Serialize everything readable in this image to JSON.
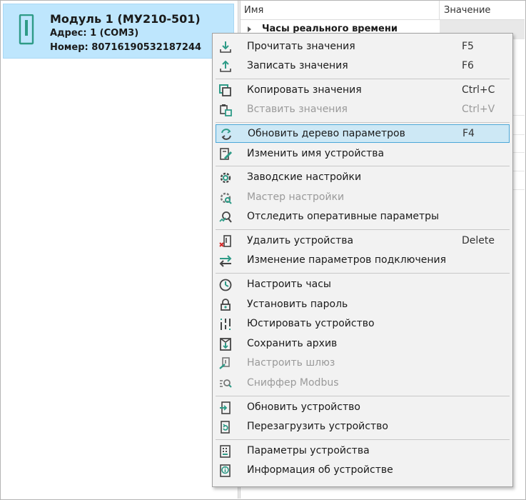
{
  "device": {
    "name": "Модуль 1 (МУ210-501)",
    "address": "Адрес: 1 (COM3)",
    "number": "Номер: 80716190532187244"
  },
  "grid": {
    "col_name": "Имя",
    "col_value": "Значение",
    "rows": [
      {
        "label": "Часы реального времени",
        "expanded": false
      }
    ]
  },
  "menu": {
    "items": [
      {
        "label": "Прочитать значения",
        "shortcut": "F5",
        "icon": "read-values-icon",
        "enabled": true
      },
      {
        "label": "Записать значения",
        "shortcut": "F6",
        "icon": "write-values-icon",
        "enabled": true
      },
      {
        "label": "Копировать значения",
        "shortcut": "Ctrl+C",
        "icon": "copy-icon",
        "enabled": true
      },
      {
        "label": "Вставить значения",
        "shortcut": "Ctrl+V",
        "icon": "paste-icon",
        "enabled": false
      },
      {
        "label": "Обновить дерево параметров",
        "shortcut": "F4",
        "icon": "refresh-tree-icon",
        "enabled": true,
        "highlighted": true
      },
      {
        "label": "Изменить имя устройства",
        "shortcut": "",
        "icon": "rename-device-icon",
        "enabled": true
      },
      {
        "label": "Заводские настройки",
        "shortcut": "",
        "icon": "factory-settings-gear-icon",
        "enabled": true
      },
      {
        "label": "Мастер настройки",
        "shortcut": "",
        "icon": "setup-wizard-icon",
        "enabled": false
      },
      {
        "label": "Отследить оперативные параметры",
        "shortcut": "",
        "icon": "track-parameters-icon",
        "enabled": true
      },
      {
        "label": "Удалить устройства",
        "shortcut": "Delete",
        "icon": "delete-device-icon",
        "enabled": true
      },
      {
        "label": "Изменение параметров подключения",
        "shortcut": "",
        "icon": "connection-arrows-icon",
        "enabled": true
      },
      {
        "label": "Настроить часы",
        "shortcut": "",
        "icon": "clock-icon",
        "enabled": true
      },
      {
        "label": "Установить пароль",
        "shortcut": "",
        "icon": "password-lock-icon",
        "enabled": true
      },
      {
        "label": "Юстировать устройство",
        "shortcut": "",
        "icon": "calibrate-icon",
        "enabled": true
      },
      {
        "label": "Сохранить архив",
        "shortcut": "",
        "icon": "save-archive-icon",
        "enabled": true
      },
      {
        "label": "Настроить шлюз",
        "shortcut": "",
        "icon": "gateway-icon",
        "enabled": false
      },
      {
        "label": "Сниффер Modbus",
        "shortcut": "",
        "icon": "modbus-sniffer-icon",
        "enabled": false
      },
      {
        "label": "Обновить устройство",
        "shortcut": "",
        "icon": "update-device-icon",
        "enabled": true
      },
      {
        "label": "Перезагрузить устройство",
        "shortcut": "",
        "icon": "reboot-device-icon",
        "enabled": true
      },
      {
        "label": "Параметры устройства",
        "shortcut": "",
        "icon": "device-parameters-icon",
        "enabled": true
      },
      {
        "label": "Информация об устройстве",
        "shortcut": "",
        "icon": "device-info-icon",
        "enabled": true
      }
    ]
  },
  "colors": {
    "accent": "#2e9b87",
    "selection": "#bee6fd",
    "highlight": "#cde8f5",
    "highlight_border": "#4ba7d8",
    "disabled_text": "#9a9a9a"
  }
}
